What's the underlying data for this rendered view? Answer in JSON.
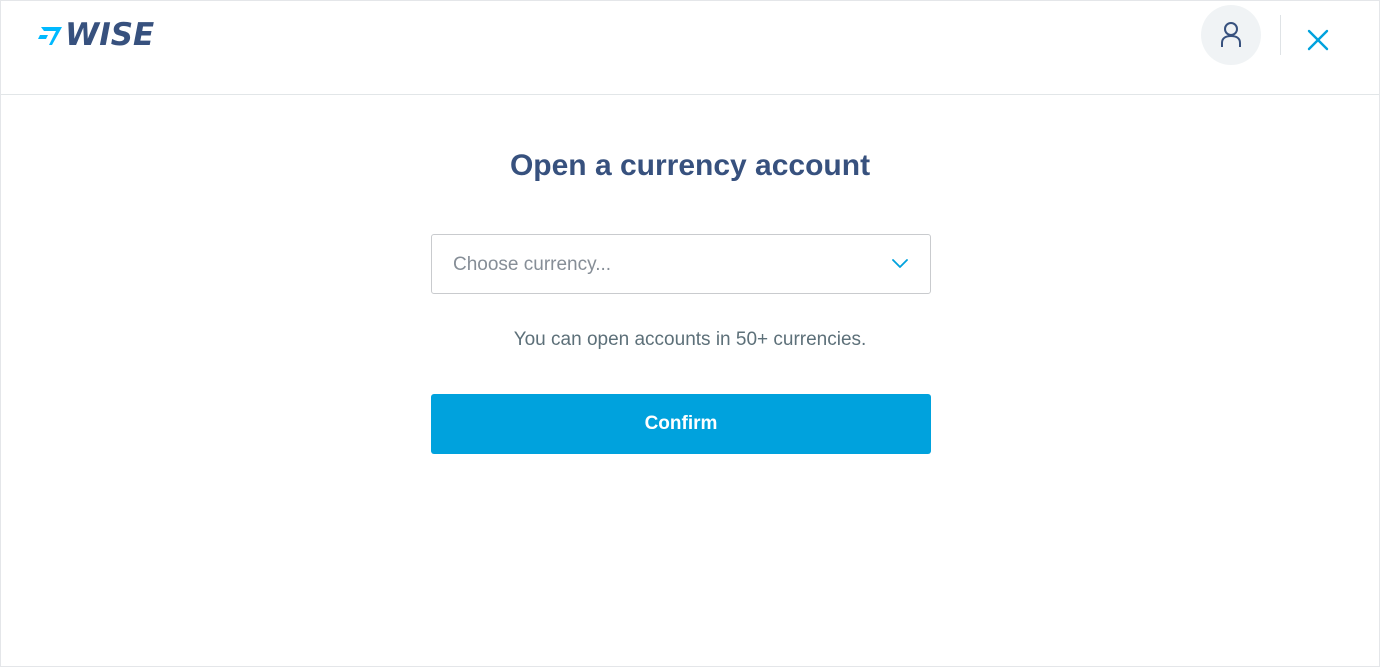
{
  "header": {
    "logo_text": "WISE",
    "avatar_icon": "user-icon",
    "close_icon": "close-icon"
  },
  "main": {
    "title": "Open a currency account",
    "currency_select": {
      "placeholder": "Choose currency...",
      "chevron_icon": "chevron-down-icon"
    },
    "hint": "You can open accounts in 50+ currencies.",
    "confirm_label": "Confirm"
  },
  "colors": {
    "brand_navy": "#37517e",
    "accent_blue": "#00a2dd",
    "flag_cyan": "#00b9ff"
  }
}
